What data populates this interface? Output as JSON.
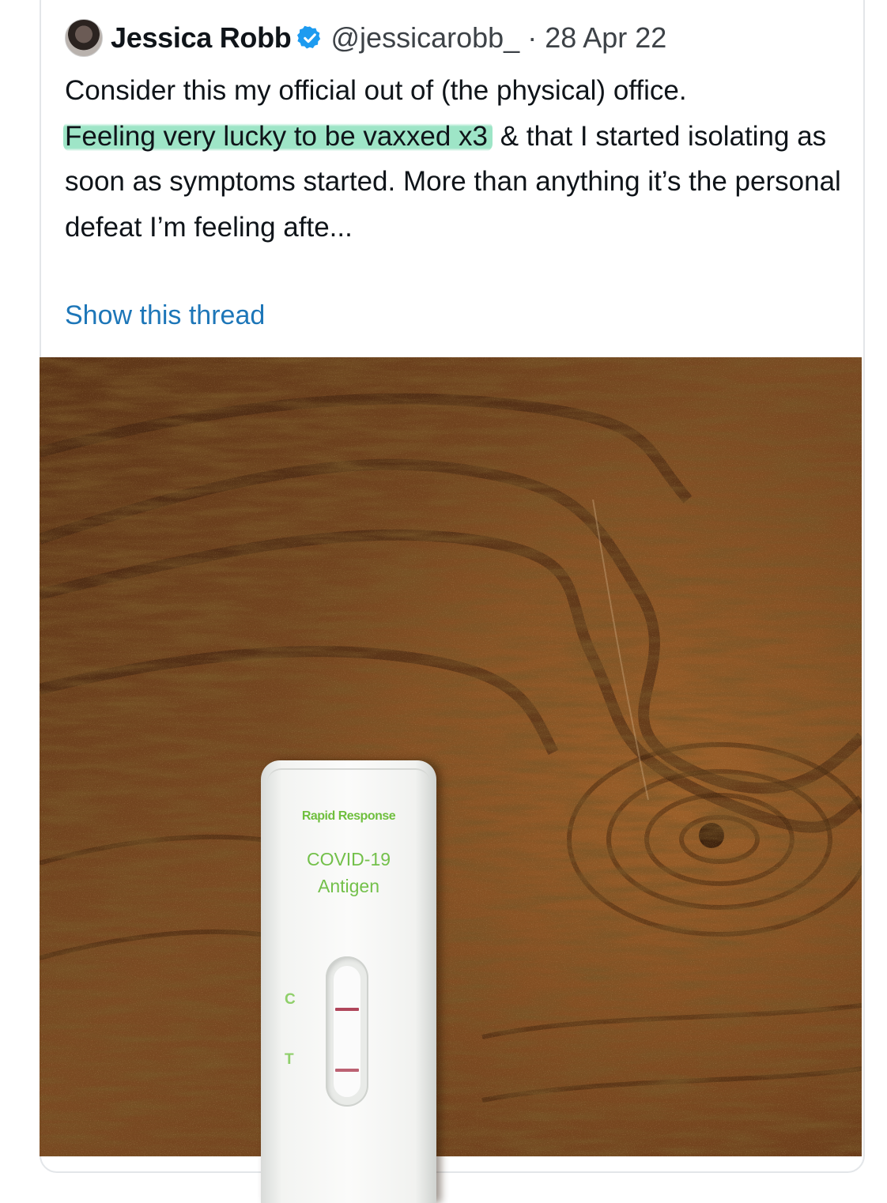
{
  "tweet": {
    "author_name": "Jessica Robb",
    "verified_icon": "verified-badge-icon",
    "handle": "@jessicarobb_",
    "separator": "·",
    "date": "28 Apr 22",
    "text_paragraph_1": "Consider this my official out of (the physical) office.",
    "text_highlighted": "Feeling very lucky to be vaxxed x3",
    "text_paragraph_2_rest": " & that I started isolating as soon as symptoms started. More than anything it’s the personal defeat I’m feeling afte...",
    "show_thread_label": "Show this thread",
    "highlight_color": "#7ddcb4",
    "link_color": "#1d76b8"
  },
  "media": {
    "test_brand": "Rapid Response",
    "test_product_line1": "COVID-19",
    "test_product_line2": "Antigen",
    "label_c": "C",
    "label_t": "T",
    "wood_color": "#6b3f1c",
    "result_line_color": "#b0465b"
  }
}
